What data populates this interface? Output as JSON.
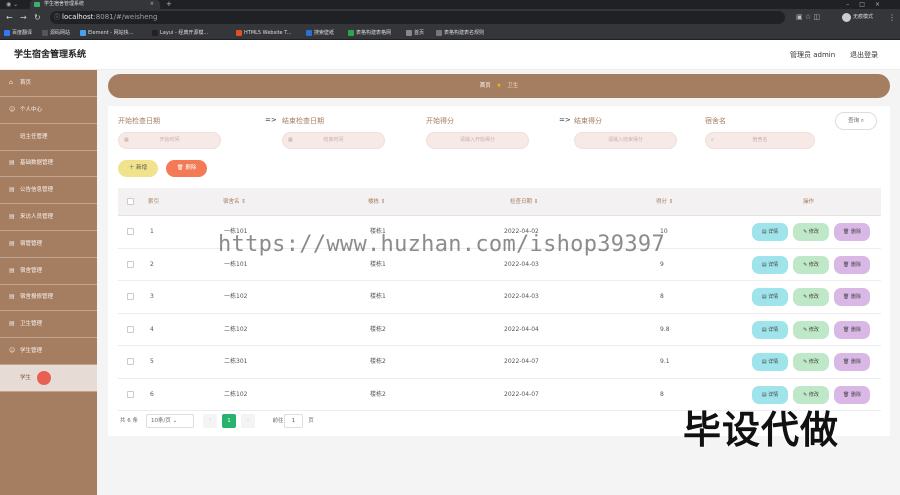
{
  "browser": {
    "tab_title": "学生宿舍管理系统",
    "tab_close": "×",
    "new_tab": "+",
    "window_controls": "–□×",
    "url_host": "localhost",
    "url_path": ":8081/#/weisheng",
    "profile_label": "无痕模式",
    "bookmarks": [
      {
        "label": "百度翻译",
        "color": "#3478f6"
      },
      {
        "label": "源码网站",
        "color": "#555555"
      },
      {
        "label": "Element - 网站快...",
        "color": "#4aa0f0"
      },
      {
        "label": "Layui - 经典开源模...",
        "color": "#222222"
      },
      {
        "label": "HTML5 Website T...",
        "color": "#e44d26"
      },
      {
        "label": "搜索壁纸",
        "color": "#2c6fd6"
      },
      {
        "label": "表格构建表格网",
        "color": "#2da44e"
      },
      {
        "label": "首页",
        "color": "#888888"
      },
      {
        "label": "表格构建表名规则",
        "color": "#777777"
      }
    ]
  },
  "header": {
    "title": "学生宿舍管理系统",
    "user": "管理员 admin",
    "logout": "退出登录"
  },
  "sidebar": {
    "items": [
      {
        "label": "首页",
        "icon": "⌂"
      },
      {
        "label": "个人中心",
        "icon": "☺"
      },
      {
        "label": "班主任管理",
        "icon": ""
      },
      {
        "label": "基础数据管理",
        "icon": "▤"
      },
      {
        "label": "公告信息管理",
        "icon": "▤"
      },
      {
        "label": "来访人员管理",
        "icon": "▤"
      },
      {
        "label": "宿管管理",
        "icon": "▤"
      },
      {
        "label": "宿舍管理",
        "icon": "▤"
      },
      {
        "label": "宿舍报修管理",
        "icon": "▤"
      },
      {
        "label": "卫生管理",
        "icon": "▤"
      },
      {
        "label": "学生管理",
        "icon": "☺"
      },
      {
        "label": "学生",
        "icon": ""
      }
    ]
  },
  "breadcrumb": {
    "home": "首页",
    "current": "卫生",
    "sep": "★"
  },
  "filters": {
    "start_date_label": "开始检查日期",
    "start_date_placeholder": "开始时间",
    "end_date_label": "结束检查日期",
    "end_date_placeholder": "结束时间",
    "start_score_label": "开始得分",
    "start_score_placeholder": "请输入开始得分",
    "end_score_label": "结束得分",
    "end_score_placeholder": "请输入结束得分",
    "dorm_label": "宿舍名",
    "dorm_placeholder": "宿舍名",
    "arrow": "=>",
    "query_button": "查询"
  },
  "actions": {
    "add": "新增",
    "delete": "删除"
  },
  "table": {
    "columns": [
      "索引",
      "宿舍名",
      "楼栋",
      "检查日期",
      "得分",
      "操作"
    ],
    "rows": [
      {
        "index": "1",
        "dorm": "一栋101",
        "building": "楼栋1",
        "date": "2022-04-02",
        "score": "10"
      },
      {
        "index": "2",
        "dorm": "一栋101",
        "building": "楼栋1",
        "date": "2022-04-03",
        "score": "9"
      },
      {
        "index": "3",
        "dorm": "一栋102",
        "building": "楼栋1",
        "date": "2022-04-03",
        "score": "8"
      },
      {
        "index": "4",
        "dorm": "二栋102",
        "building": "楼栋2",
        "date": "2022-04-04",
        "score": "9.8"
      },
      {
        "index": "5",
        "dorm": "二栋301",
        "building": "楼栋2",
        "date": "2022-04-07",
        "score": "9.1"
      },
      {
        "index": "6",
        "dorm": "二栋102",
        "building": "楼栋2",
        "date": "2022-04-07",
        "score": "8"
      }
    ],
    "row_actions": {
      "detail": "详情",
      "edit": "修改",
      "delete": "删除"
    }
  },
  "pagination": {
    "total": "共 6 条",
    "page_size": "10条/页",
    "current_page": "1",
    "goto_label": "前往",
    "goto_value": "1",
    "goto_unit": "页"
  },
  "watermark": {
    "url": "https://www.huzhan.com/ishop39397",
    "big": "毕设代做"
  },
  "colors": {
    "sidebar": "#a57e62",
    "accent": "#a57e62",
    "detail": "#9fe4ea",
    "edit": "#bfe8c8",
    "delete": "#d9b8e6",
    "add": "#f1e28c",
    "bulk_delete": "#f47a55",
    "pager_active": "#27b36b"
  }
}
